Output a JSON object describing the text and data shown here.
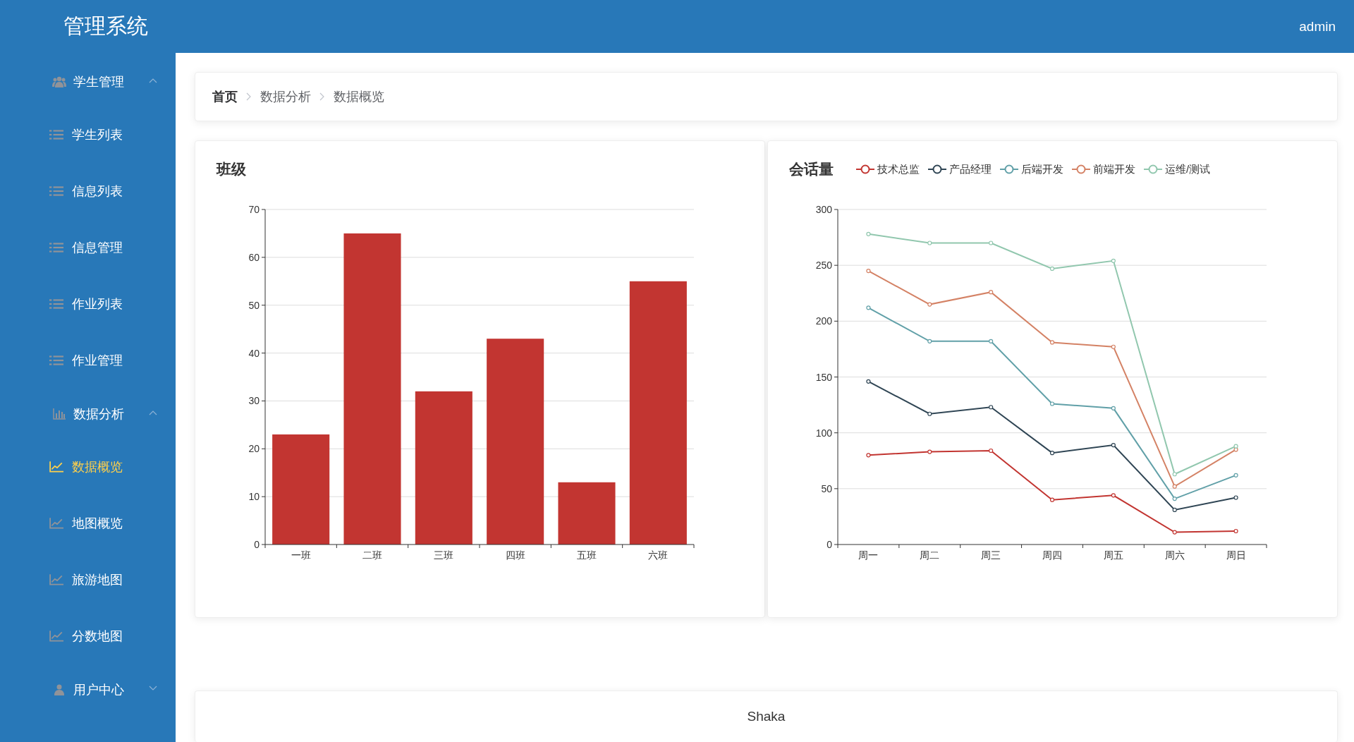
{
  "header": {
    "title": "管理系统",
    "user": "admin"
  },
  "sidebar": {
    "groups": [
      {
        "label": "学生管理",
        "expanded": true,
        "children": [
          {
            "label": "学生列表",
            "selected": false
          },
          {
            "label": "信息列表",
            "selected": false
          },
          {
            "label": "信息管理",
            "selected": false
          },
          {
            "label": "作业列表",
            "selected": false
          },
          {
            "label": "作业管理",
            "selected": false
          }
        ]
      },
      {
        "label": "数据分析",
        "expanded": true,
        "children": [
          {
            "label": "数据概览",
            "selected": true
          },
          {
            "label": "地图概览",
            "selected": false
          },
          {
            "label": "旅游地图",
            "selected": false
          },
          {
            "label": "分数地图",
            "selected": false
          }
        ]
      },
      {
        "label": "用户中心",
        "expanded": false
      }
    ]
  },
  "breadcrumb": [
    "首页",
    "数据分析",
    "数据概览"
  ],
  "charts": [
    {
      "chart_data": {
        "type": "bar",
        "title": "班级",
        "categories": [
          "一班",
          "二班",
          "三班",
          "四班",
          "五班",
          "六班"
        ],
        "values": [
          23,
          65,
          32,
          43,
          13,
          55
        ],
        "ylim": [
          0,
          70
        ],
        "grid": true,
        "yticks": [
          0,
          10,
          20,
          30,
          40,
          50,
          60,
          70
        ]
      }
    },
    {
      "chart_data": {
        "type": "line",
        "title": "会话量",
        "categories": [
          "周一",
          "周二",
          "周三",
          "周四",
          "周五",
          "周六",
          "周日"
        ],
        "ylim": [
          0,
          300
        ],
        "grid": true,
        "yticks": [
          0,
          50,
          100,
          150,
          200,
          250,
          300
        ],
        "series": [
          {
            "name": "技术总监",
            "color": "#c23531",
            "marker": "circle",
            "values": [
              80,
              83,
              84,
              40,
              44,
              11,
              12
            ]
          },
          {
            "name": "产品经理",
            "color": "#2f4554",
            "marker": "circle",
            "values": [
              146,
              117,
              123,
              82,
              89,
              31,
              42
            ]
          },
          {
            "name": "后端开发",
            "color": "#61a0a8",
            "marker": "circle",
            "values": [
              212,
              182,
              182,
              126,
              122,
              41,
              62
            ]
          },
          {
            "name": "前端开发",
            "color": "#d48265",
            "marker": "circle",
            "values": [
              245,
              215,
              226,
              181,
              177,
              52,
              85
            ]
          },
          {
            "name": "运维/测试",
            "color": "#91c7ae",
            "marker": "circle",
            "values": [
              278,
              270,
              270,
              247,
              254,
              63,
              88
            ]
          }
        ]
      }
    }
  ],
  "footer": {
    "text": "Shaka"
  }
}
